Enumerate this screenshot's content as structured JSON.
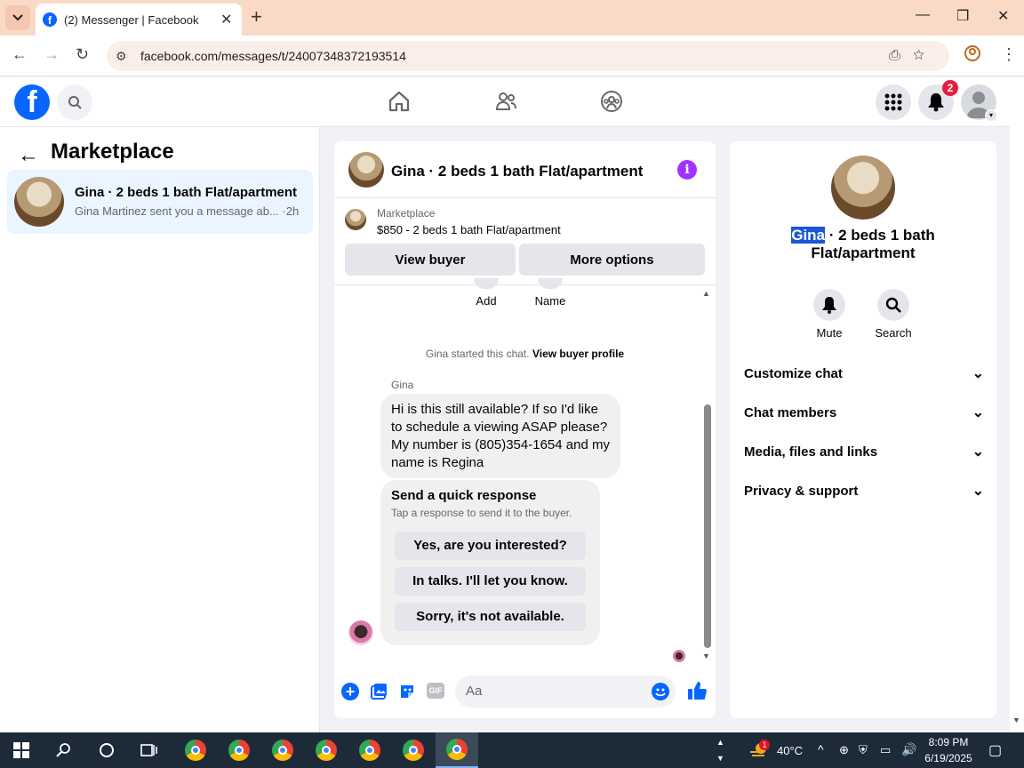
{
  "browser": {
    "tab_title": "(2) Messenger | Facebook",
    "url": "facebook.com/messages/t/24007348372193514"
  },
  "fb_header": {
    "notifications_count": "2"
  },
  "sidebar": {
    "title": "Marketplace",
    "conversation": {
      "title": "Gina · 2 beds 1 bath Flat/apartment",
      "snippet": "Gina Martinez sent you a message ab... ·2h"
    }
  },
  "chat": {
    "title": "Gina · 2 beds 1 bath Flat/apartment",
    "listing_category": "Marketplace",
    "listing_price": "$850 - 2 beds 1 bath Flat/apartment",
    "view_buyer_label": "View buyer",
    "more_options_label": "More options",
    "add_label": "Add",
    "name_label": "Name",
    "started_text": "Gina started this chat.",
    "view_profile_link": "View buyer profile",
    "sender_name": "Gina",
    "message_text": "Hi is this still available? If so I'd like to schedule a viewing ASAP please? My number is (805)354-1654 and my name is Regina",
    "quick_title": "Send a quick response",
    "quick_subtitle": "Tap a response to send it to the buyer.",
    "quick_responses": [
      "Yes, are you interested?",
      "In talks. I'll let you know.",
      "Sorry, it's not available."
    ],
    "composer_placeholder": "Aa"
  },
  "right_panel": {
    "title_highlight": "Gina",
    "title_rest": " · 2 beds 1 bath Flat/apartment",
    "mute_label": "Mute",
    "search_label": "Search",
    "sections": [
      "Customize chat",
      "Chat members",
      "Media, files and links",
      "Privacy & support"
    ]
  },
  "taskbar": {
    "weather_badge": "1",
    "temperature": "40°C",
    "time": "8:09 PM",
    "date": "6/19/2025"
  }
}
